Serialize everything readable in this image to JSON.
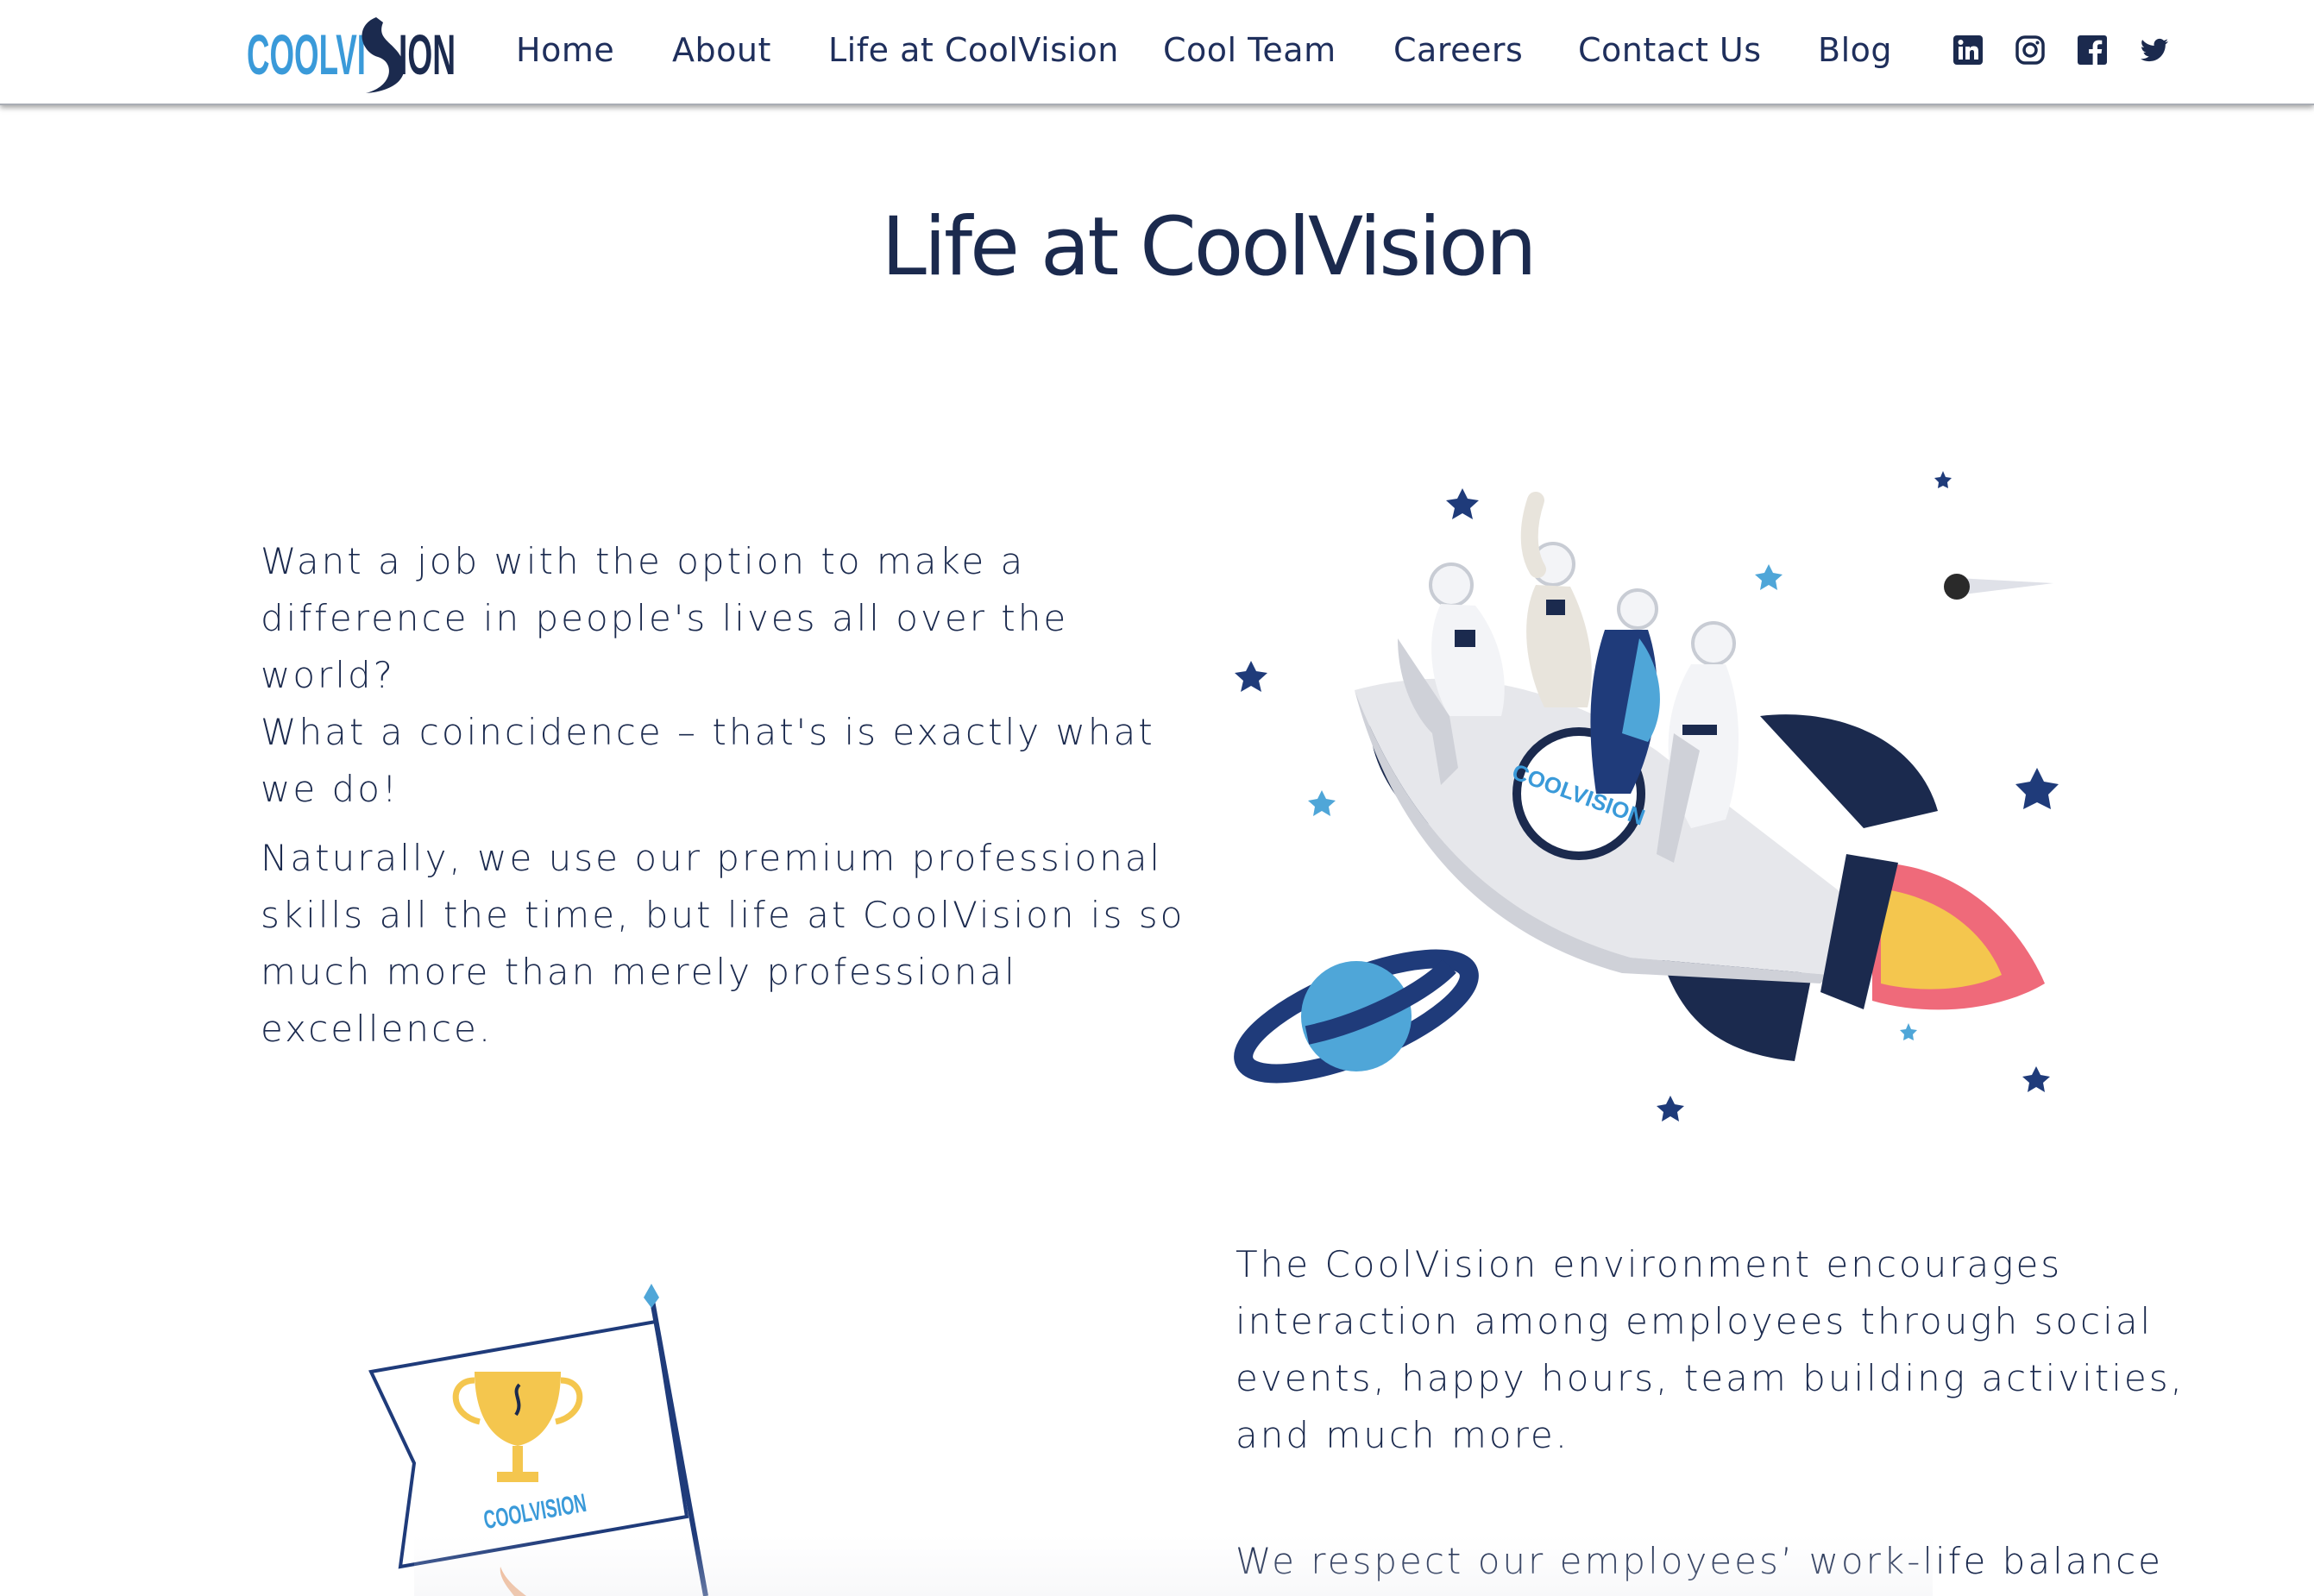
{
  "brand": {
    "logo_text_light": "COOLVI",
    "logo_text_dark": "ION",
    "color_primary": "#1b2a4e",
    "color_accent": "#3a9ad9"
  },
  "nav": {
    "items": [
      {
        "label": "Home"
      },
      {
        "label": "About"
      },
      {
        "label": "Life at CoolVision"
      },
      {
        "label": "Cool Team"
      },
      {
        "label": "Careers"
      },
      {
        "label": "Contact Us"
      },
      {
        "label": "Blog"
      }
    ],
    "social": [
      {
        "icon": "linkedin-icon"
      },
      {
        "icon": "instagram-icon"
      },
      {
        "icon": "facebook-icon"
      },
      {
        "icon": "twitter-icon"
      }
    ]
  },
  "main": {
    "title": "Life at CoolVision",
    "intro_lines": [
      "Want a job with the option to make a",
      "difference in people's lives all over the world?",
      "What a coincidence – that's is exactly what",
      "we do!"
    ],
    "second_lines": [
      "Naturally, we use our premium professional",
      "skills all the time, but life at CoolVision is so",
      "much more than merely professional",
      "excellence."
    ],
    "environment_lines": [
      "The CoolVision environment encourages",
      "interaction among employees through social",
      "events, happy hours, team building activities,",
      "and much more."
    ],
    "balance_lines": [
      "We respect our employees’ work-life balance"
    ],
    "rocket_badge_text": "COOLVISION",
    "flag_badge_text": "COOLVISION"
  }
}
